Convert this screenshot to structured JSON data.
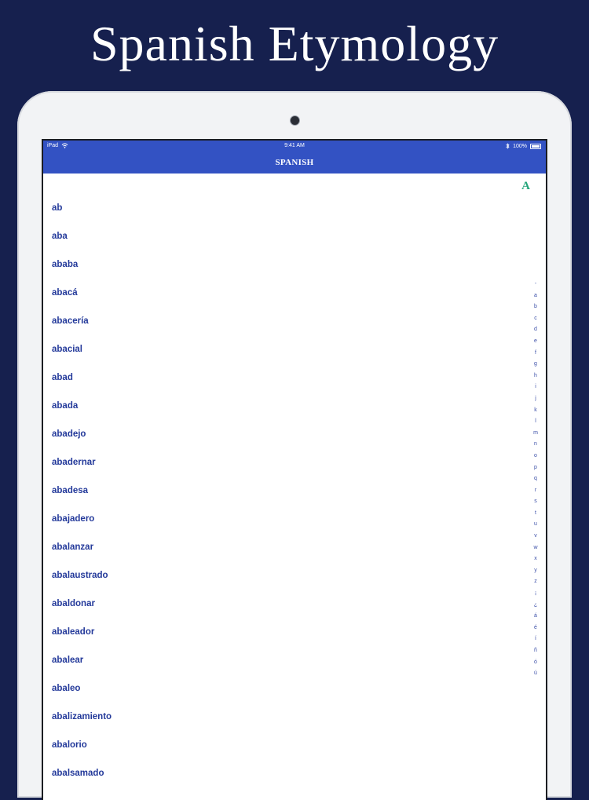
{
  "banner": {
    "title": "Spanish Etymology"
  },
  "status_bar": {
    "device": "iPad",
    "time": "9:41 AM",
    "battery": "100%"
  },
  "navbar": {
    "title": "SPANISH"
  },
  "section_header": "A",
  "words": [
    "ab",
    "aba",
    "ababa",
    "abacá",
    "abacería",
    "abacial",
    "abad",
    "abada",
    "abadejo",
    "abadernar",
    "abadesa",
    "abajadero",
    "abalanzar",
    "abalaustrado",
    "abaldonar",
    "abaleador",
    "abalear",
    "abaleo",
    "abalizamiento",
    "abalorio",
    "abalsamado"
  ],
  "index_letters": [
    "-",
    "a",
    "b",
    "c",
    "d",
    "e",
    "f",
    "g",
    "h",
    "i",
    "j",
    "k",
    "l",
    "m",
    "n",
    "o",
    "p",
    "q",
    "r",
    "s",
    "t",
    "u",
    "v",
    "w",
    "x",
    "y",
    "z",
    "¡",
    "¿",
    "á",
    "é",
    "í",
    "ñ",
    "ó",
    "ú"
  ],
  "colors": {
    "background": "#16204e",
    "accent_bar": "#3352c3",
    "word_text": "#23399a",
    "section_letter": "#23a57a"
  },
  "icons": {
    "wifi": "wifi-icon",
    "bluetooth": "bluetooth-icon",
    "battery": "battery-icon"
  }
}
